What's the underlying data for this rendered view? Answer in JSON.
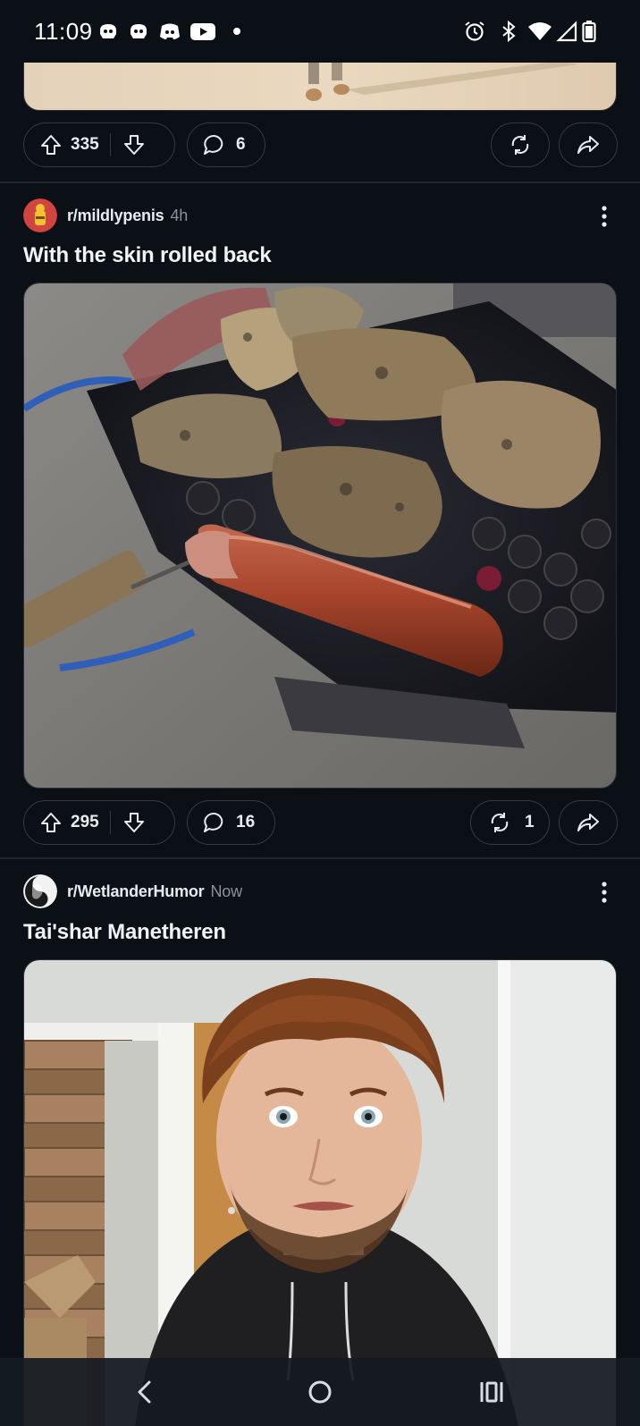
{
  "status_bar": {
    "time": "11:09",
    "left_icons": [
      "robot-icon",
      "robot-icon",
      "discord-icon",
      "youtube-icon",
      "dot-icon"
    ],
    "right_icons": [
      "alarm-icon",
      "bluetooth-icon",
      "wifi-icon",
      "signal-icon",
      "battery-icon"
    ]
  },
  "posts": [
    {
      "upvotes": "335",
      "comments": "6"
    },
    {
      "subreddit": "r/mildlypenis",
      "time": "4h",
      "title": "With the skin rolled back",
      "upvotes": "295",
      "comments": "16",
      "crossposts": "1"
    },
    {
      "subreddit": "r/WetlanderHumor",
      "time": "Now",
      "title": "Tai'shar Manetheren"
    }
  ],
  "nav_bar": {
    "buttons": [
      "back-icon",
      "home-icon",
      "recents-icon"
    ]
  },
  "colors": {
    "background": "#0b1016",
    "pill_border": "#343b43",
    "text": "#eef1f3",
    "muted": "#8a9299"
  }
}
